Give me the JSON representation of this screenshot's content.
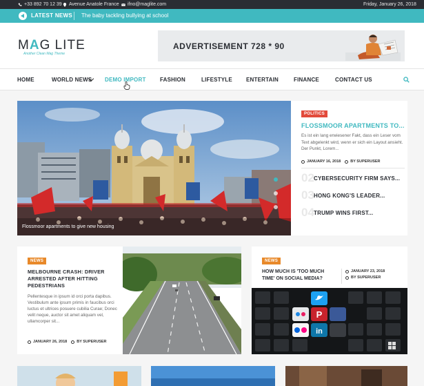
{
  "topbar": {
    "phone": "+33 892 70 12 39",
    "address": "Avenue Anatole France",
    "email": "ifno@maglite.com",
    "date": "Friday, January 26, 2018"
  },
  "ticker": {
    "label": "LATEST NEWS",
    "headline": "The baby tackling bullying at school"
  },
  "logo": {
    "name_prefix": "M",
    "name_accent": "A",
    "name_suffix": "G LITE",
    "tagline": "Another Clean Mag Theme"
  },
  "ad": {
    "text": "ADVERTISEMENT 728 * 90"
  },
  "nav": {
    "items": [
      "HOME",
      "WORLD NEWS",
      "DEMO IMPORT",
      "FASHION",
      "LIFESTYLE",
      "ENTERTAIN",
      "FINANCE",
      "CONTACT US"
    ],
    "active_index": 2
  },
  "hero": {
    "caption": "Flossmoor apartments to give new housing",
    "slider_dot_count": 3,
    "slider_active_dot": 1
  },
  "featured": {
    "badge": "POLITICS",
    "title": "FLOSSMOOR APARTMENTS TO...",
    "excerpt": "Es ist ein lang erwiesener Fakt, dass ein Leser vom Text abgelenkt wird, wenn er sich ein Layout ansieht. Der Punkt, Lorem...",
    "date": "JANUARY 16, 2018",
    "author": "BY SUPERUSER",
    "related": [
      {
        "num": "02",
        "title": "CYBERSECURITY FIRM SAYS..."
      },
      {
        "num": "03",
        "title": "HONG KONG'S LEADER..."
      },
      {
        "num": "04",
        "title": "TRUMP WINS FIRST..."
      }
    ]
  },
  "card_news_1": {
    "badge": "NEWS",
    "title": "MELBOURNE CRASH: DRIVER ARRESTED AFTER HITTING PEDESTRIANS",
    "excerpt": "Pellentesque in ipsum id orci porta dapibus. Vestibulum ante ipsum primis in faucibus orci luctus et ultrices posuere cubilia Curae; Donec velit neque, auctor sit amet aliquam vel, ullamcorper sit...",
    "date": "JANUARY 26, 2018",
    "author": "BY SUPERUSER"
  },
  "card_news_2": {
    "badge": "NEWS",
    "title": "HOW MUCH IS 'TOO MUCH TIME' ON SOCIAL MEDIA?",
    "date": "JANUARY 23, 2018",
    "author": "BY SUPERUSER"
  },
  "colors": {
    "accent": "#40b9c0",
    "dark": "#2a2d33",
    "politics": "#e24a3b",
    "news": "#e8892a"
  }
}
